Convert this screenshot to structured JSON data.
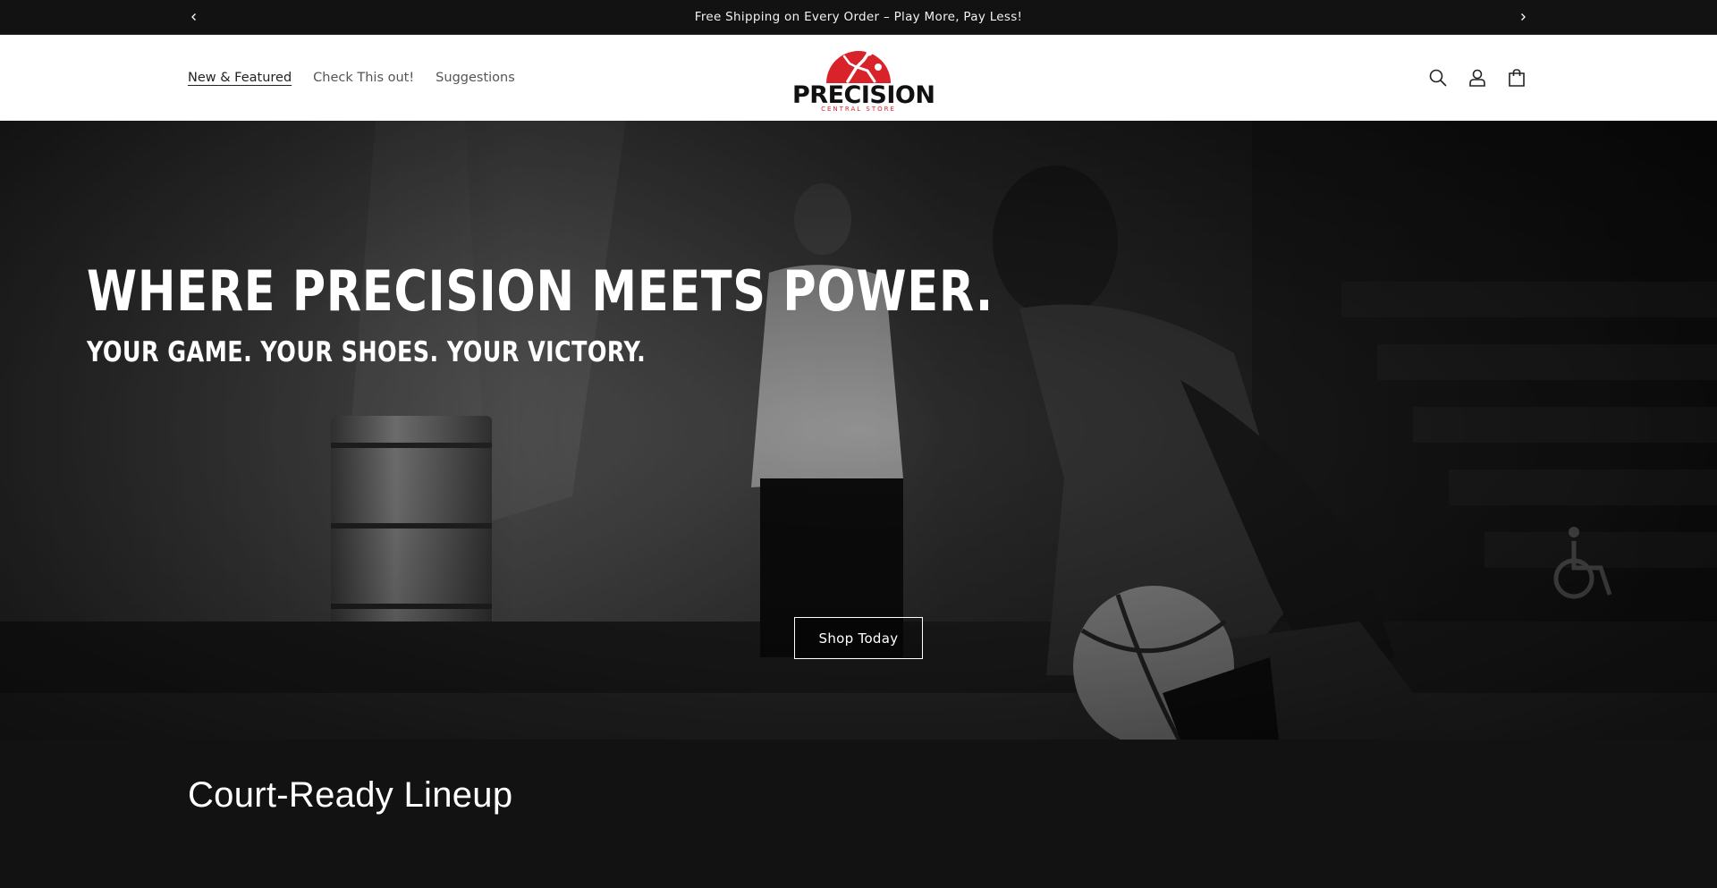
{
  "announcement": {
    "message": "Free Shipping on Every Order – Play More, Pay Less!"
  },
  "header": {
    "nav": [
      {
        "label": "New & Featured",
        "active": true
      },
      {
        "label": "Check This out!",
        "active": false
      },
      {
        "label": "Suggestions",
        "active": false
      }
    ],
    "logo": {
      "word": "PRECISION",
      "sub": "CENTRAL STORE"
    },
    "icons": [
      "search-icon",
      "account-icon",
      "cart-icon"
    ]
  },
  "hero": {
    "headline": "WHERE PRECISION MEETS POWER.",
    "subheadline": "YOUR GAME. YOUR SHOES. YOUR VICTORY.",
    "cta_label": "Shop Today"
  },
  "section": {
    "title": "Court-Ready Lineup"
  },
  "colors": {
    "brand_red": "#d9232a",
    "dark_bg": "#121212",
    "header_bg": "#ffffff"
  }
}
